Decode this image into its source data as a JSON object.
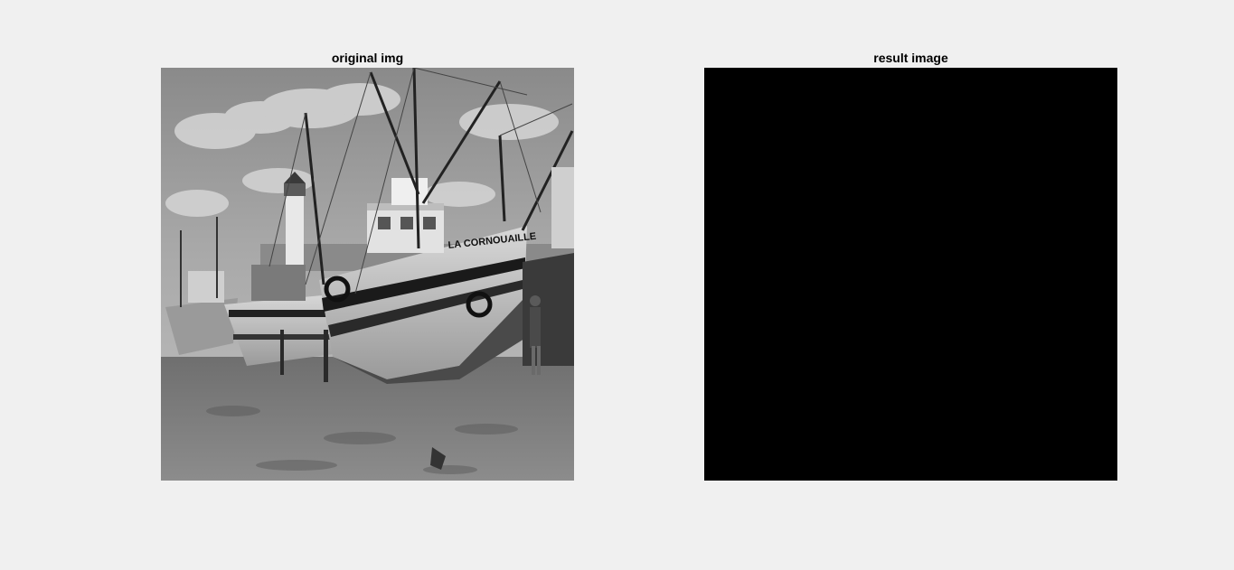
{
  "figure": {
    "background": "#f0f0f0",
    "subplots": [
      {
        "title": "original img"
      },
      {
        "title": "result image",
        "fill_color": "#000000"
      }
    ]
  },
  "boat_text": "LA CORNOUAILLE"
}
